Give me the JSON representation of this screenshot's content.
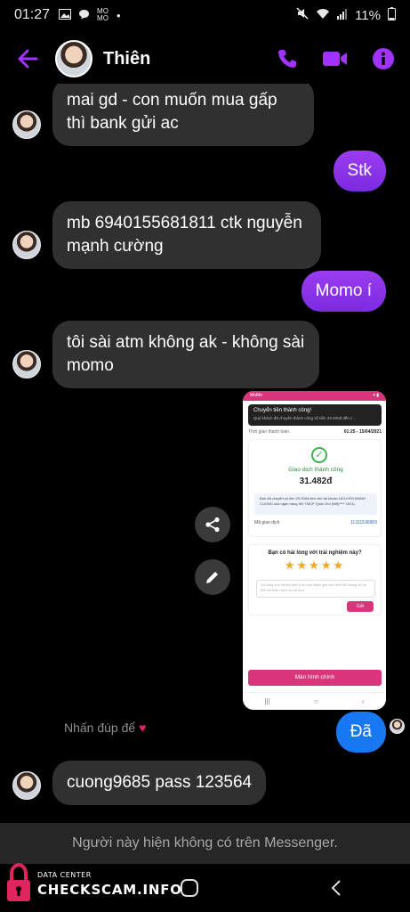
{
  "status_bar": {
    "time": "01:27",
    "momo_badge": "MO MO",
    "battery": "11%",
    "colors": {
      "text": "#e8e8e8"
    }
  },
  "header": {
    "contact_name": "Thiên",
    "accent_color": "#a033ff",
    "icons": [
      "back-arrow-icon",
      "phone-icon",
      "video-camera-icon",
      "info-icon"
    ]
  },
  "messages": [
    {
      "from": "them",
      "text": "mai gd - con muốn mua gấp thì bank gửi ac"
    },
    {
      "from": "me",
      "text": "Stk"
    },
    {
      "from": "them",
      "text": "mb 6940155681811 ctk nguyễn mạnh cường"
    },
    {
      "from": "me",
      "text": "Momo í"
    },
    {
      "from": "them",
      "text": "tôi sài atm không ak - không sài momo"
    },
    {
      "from": "me",
      "type": "image",
      "description_label": "momo-receipt-screenshot"
    },
    {
      "from": "me",
      "text": "Đã"
    },
    {
      "from": "them",
      "text": "cuong9685 pass 123564"
    }
  ],
  "receipt": {
    "app_name": "MoMo",
    "notification_title": "Chuyển tiền thành công!",
    "notification_body": "Quý khách đã chuyển thành công số tiền 29.000đ đến c...",
    "time_label": "Thời gian thanh toán",
    "time_value": "01:25 - 15/04/2021",
    "status": "Giao dịch thành công",
    "amount": "31.482đ",
    "info_text": "Bạn đã chuyển số tiền 29.000đ đến chủ tài khoản NGUYEN MANH CUONG của ngân hàng NH TMCP Quan Doi (MB)**** 1811)",
    "txn_label": "Mã giao dịch",
    "txn_value": "11311536903",
    "rating_question": "Bạn có hài lòng với trải nghiệm này?",
    "stars": "★★★★★",
    "feedback_placeholder": "Vui lòng cho MoMo biết ý do bạn đánh giá như trên để chúng tôi có thể cải thiện dịch vụ tốt hơn",
    "send_label": "Gửi",
    "home_label": "Màn hình chính"
  },
  "hint": {
    "text": "Nhấn đúp để",
    "heart": "♥"
  },
  "unavailable_text": "Người này hiện không có trên Messenger.",
  "watermark": {
    "small": "DATA CENTER",
    "big": "CHECKSCAM.INFO"
  }
}
